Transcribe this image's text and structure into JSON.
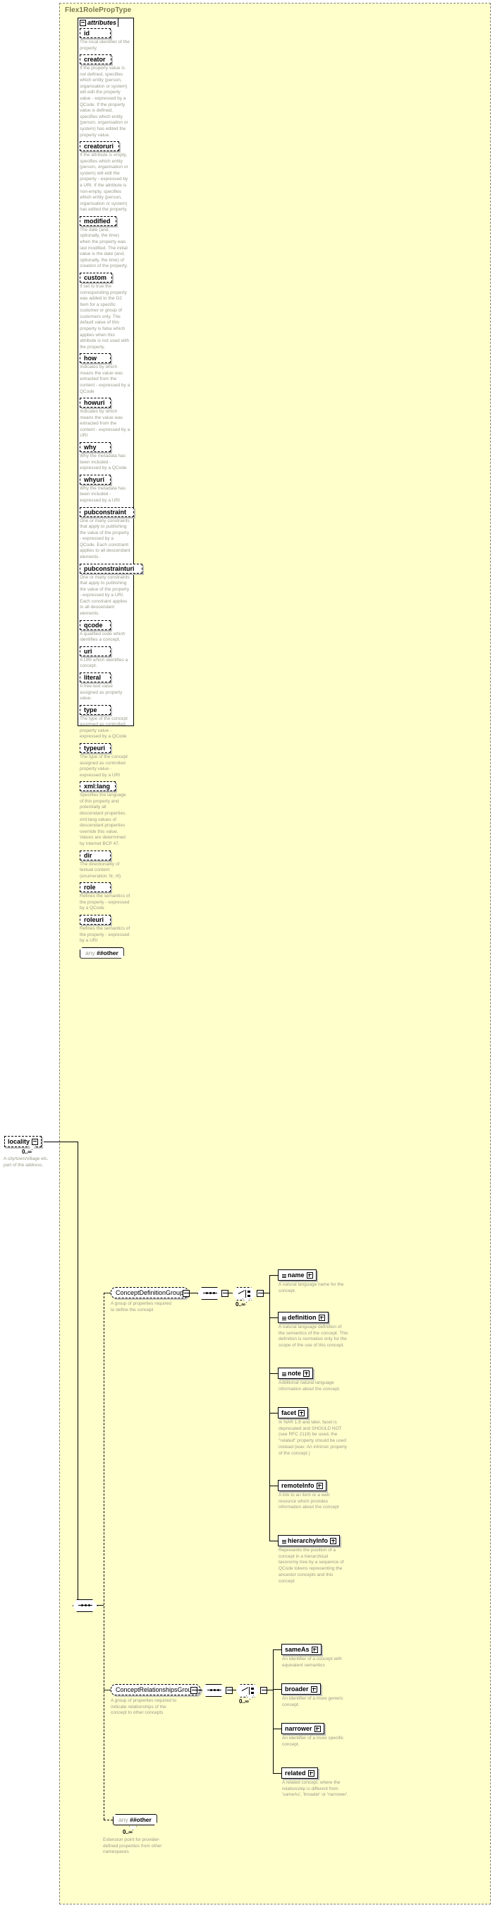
{
  "diagram": {
    "type_name": "Flex1RolePropType",
    "attributes_label": "attributes",
    "any_keyword": "any",
    "any_namespace": "##other",
    "colors": {
      "background": "#ffffcc",
      "frame": "#808080",
      "text": "#000000",
      "description": "#9a9a8a"
    }
  },
  "attributes": [
    {
      "name": "id",
      "description": "The local identifier of the property."
    },
    {
      "name": "creator",
      "description": "If the property value is not defined, specifies which entity (person, organisation or system) will edit the property value - expressed by a QCode. If the property value is defined, specifies which entity (person, organisation or system) has edited the property value."
    },
    {
      "name": "creatoruri",
      "description": "If the attribute is empty, specifies which entity (person, organisation or system) will edit the property - expressed by a URI. If the attribute is non-empty, specifies which entity (person, organisation or system) has edited the property."
    },
    {
      "name": "modified",
      "description": "The date (and, optionally, the time) when the property was last modified. The initial value is the date (and, optionally, the time) of creation of the property."
    },
    {
      "name": "custom",
      "description": "If set to true the corresponding property was added to the G2 Item for a specific customer or group of customers only. The default value of this property is false which applies when this attribute is not used with the property."
    },
    {
      "name": "how",
      "description": "Indicates by which means the value was extracted from the content - expressed by a QCode"
    },
    {
      "name": "howuri",
      "description": "Indicates by which means the value was extracted from the content - expressed by a URI"
    },
    {
      "name": "why",
      "description": "Why the metadata has been included - expressed by a QCode"
    },
    {
      "name": "whyuri",
      "description": "Why the metadata has been included - expressed by a URI"
    },
    {
      "name": "pubconstraint",
      "description": "One or many constraints that apply to publishing the value of the property - expressed by a QCode. Each constraint applies to all descendant elements."
    },
    {
      "name": "pubconstrainturi",
      "description": "One or many constraints that apply to publishing the value of the property - expressed by a URI. Each constraint applies to all descendant elements."
    },
    {
      "name": "qcode",
      "description": "A qualified code which identifies a concept."
    },
    {
      "name": "uri",
      "description": "A URI which identifies a concept."
    },
    {
      "name": "literal",
      "description": "A free-text value assigned as property value."
    },
    {
      "name": "type",
      "description": "The type of the concept assigned as controlled property value - expressed by a QCode"
    },
    {
      "name": "typeuri",
      "description": "The type of the concept assigned as controlled property value - expressed by a URI"
    },
    {
      "name": "xml:lang",
      "description": "Specifies the language of this property and potentially all descendant properties. xml:lang values of descendant properties override this value. Values are determined by Internet BCP 47."
    },
    {
      "name": "dir",
      "description": "The directionality of textual content (enumeration: ltr, rtl)"
    },
    {
      "name": "role",
      "description": "Refines the semantics of the property - expressed by a QCode"
    },
    {
      "name": "roleuri",
      "description": "Refines the semantics of the property - expressed by a URI"
    }
  ],
  "root_element": {
    "name": "locality",
    "cardinality": "0..∞",
    "description": "A city/town/village etc. part of the address."
  },
  "groups": [
    {
      "name": "ConceptDefinitionGroup",
      "description": "A group of properites required to define the concept",
      "cardinality": "0..∞",
      "children": [
        {
          "name": "name",
          "description": "A natural language name for the concept."
        },
        {
          "name": "definition",
          "description": "A natural language definition of the semantics of the concept. This definition is normative only for the scope of the use of this concept."
        },
        {
          "name": "note",
          "description": "Additional natural language information about the concept."
        },
        {
          "name": "facet",
          "description": "In NAR 1.8 and later, facet is deprecated and SHOULD NOT (see RFC 2119) be used, the \"related\" property should be used instead (was: An intrinsic property of the concept.)"
        },
        {
          "name": "remoteInfo",
          "description": "A link to an item or a web resource which provides information about the concept"
        },
        {
          "name": "hierarchyInfo",
          "description": "Represents the position of a concept in a hierarchical taxonomy tree by a sequence of QCode tokens representing the ancestor concepts and this concept"
        }
      ]
    },
    {
      "name": "ConceptRelationshipsGroup",
      "description": "A group of properites required to indicate relationships of the concept to other concepts",
      "cardinality": "0..∞",
      "children": [
        {
          "name": "sameAs",
          "description": "An identifier of a concept with equivalent semantics"
        },
        {
          "name": "broader",
          "description": "An identifier of a more generic concept."
        },
        {
          "name": "narrower",
          "description": "An identifier of a more specific concept."
        },
        {
          "name": "related",
          "description": "A related concept, where the relationship is different from 'sameAs', 'broader' or 'narrower'."
        }
      ]
    }
  ],
  "extension": {
    "keyword": "any",
    "namespace": "##other",
    "cardinality": "0..∞",
    "description": "Extension point for provider-defined properties from other namespaces"
  }
}
